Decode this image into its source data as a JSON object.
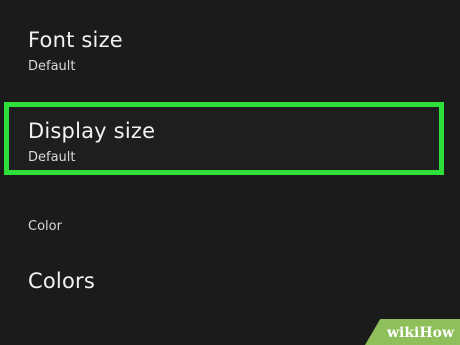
{
  "settings": {
    "font_size": {
      "title": "Font size",
      "value": "Default"
    },
    "display_size": {
      "title": "Display size",
      "value": "Default",
      "highlight_color": "#2fdf39"
    },
    "color_section_header": "Color",
    "colors": {
      "title": "Colors"
    }
  },
  "watermark": {
    "text": "wikiHow",
    "color": "#8fbf5a"
  },
  "theme": {
    "background": "#1b1b1b"
  }
}
